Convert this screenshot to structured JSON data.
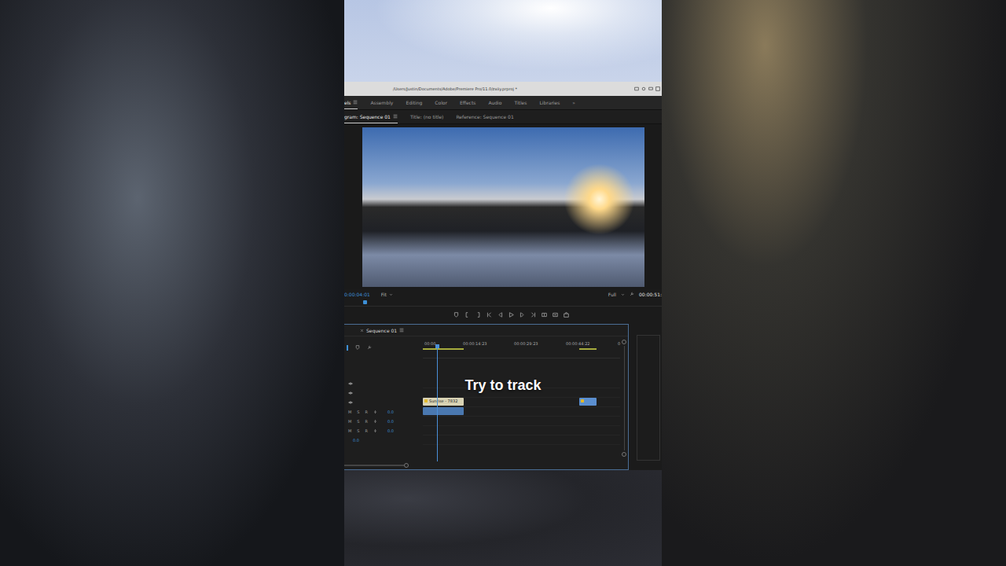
{
  "short": {
    "caption": "Try to track"
  },
  "window": {
    "title": "/Users/Justin/Documents/Adobe/Premiere Pro/11.0/zxiiy.prproj *"
  },
  "workspaces": [
    {
      "label": "els",
      "selected": true
    },
    {
      "label": "Assembly",
      "selected": false
    },
    {
      "label": "Editing",
      "selected": false
    },
    {
      "label": "Color",
      "selected": false
    },
    {
      "label": "Effects",
      "selected": false
    },
    {
      "label": "Audio",
      "selected": false
    },
    {
      "label": "Titles",
      "selected": false
    },
    {
      "label": "Libraries",
      "selected": false
    },
    {
      "label": "»",
      "selected": false
    }
  ],
  "panel_tabs": [
    {
      "label": "gram: Sequence 01",
      "selected": true
    },
    {
      "label": "Title: (no title)",
      "selected": false
    },
    {
      "label": "Reference: Sequence 01",
      "selected": false
    }
  ],
  "monitor": {
    "timecode": "0:00:04:01",
    "zoom": "Fit",
    "resolution": "Full",
    "duration": "00:00:51:",
    "level": 0.06
  },
  "timeline": {
    "tab": "Sequence 01",
    "ruler": [
      "00:00",
      "00:00:14:23",
      "00:00:29:23",
      "00:00:44:22",
      "0"
    ],
    "span_seconds": 58,
    "playhead": 0.07,
    "video_tracks": [
      {
        "visible": true
      },
      {
        "visible": true
      },
      {
        "visible": true
      }
    ],
    "audio_tracks": [
      {
        "mute": "M",
        "solo": "S",
        "record": "R",
        "volume": "0.0"
      },
      {
        "mute": "M",
        "solo": "S",
        "record": "R",
        "volume": "0.0"
      },
      {
        "mute": "M",
        "solo": "S",
        "record": "R",
        "volume": "0.0"
      }
    ],
    "master": {
      "volume": "0.0"
    },
    "clips": [
      {
        "label": "Sunrise - 7832",
        "lane": "video",
        "track": 1,
        "start": 0,
        "end": 12,
        "color": "#d9d3b4"
      },
      {
        "lane": "video",
        "track": 1,
        "start": 46,
        "end": 51,
        "color": "#5b8fd0"
      },
      {
        "lane": "audio",
        "track": 1,
        "start": 0,
        "end": 12,
        "color": "#4a78b0"
      }
    ]
  }
}
